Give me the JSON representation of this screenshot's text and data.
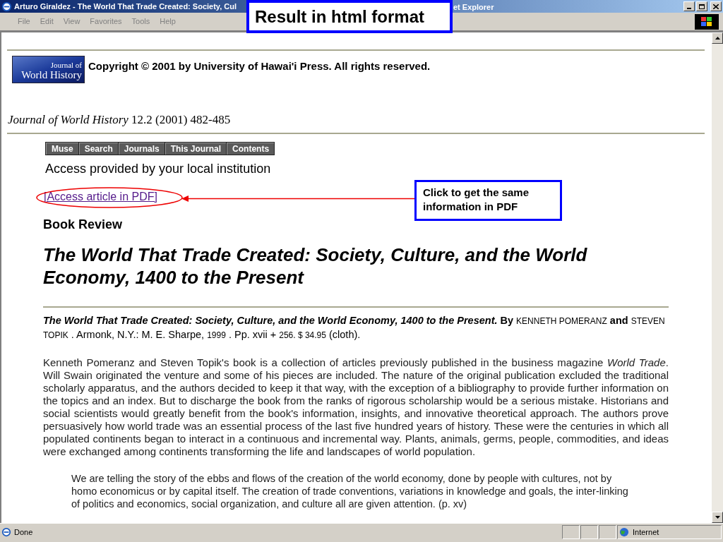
{
  "window": {
    "title_start": "Arturo Giraldez - The World That Trade Created: Society, Cul",
    "title_end": "et Explorer"
  },
  "menu": [
    "File",
    "Edit",
    "View",
    "Favorites",
    "Tools",
    "Help"
  ],
  "page": {
    "logo": [
      "Journal of",
      "World History"
    ],
    "copyright": "Copyright © 2001 by University of Hawai'i Press. All rights reserved.",
    "journal": "Journal of World History",
    "issue": "12.2 (2001) 482-485",
    "nav": [
      "Muse",
      "Search",
      "Journals",
      "This Journal",
      "Contents"
    ],
    "access": "Access provided by your local institution",
    "pdf_link": "[Access article in PDF]",
    "section": "Book Review",
    "title_lines": [
      "The World That Trade Created: Society, Culture, and the World",
      "Economy, 1400 to the Present"
    ],
    "citation": [
      {
        "kind": "title",
        "text": "The World That Trade Created: Society, Culture, and the World Economy, 1400 to the Present."
      },
      {
        "kind": "bold",
        "text": "By"
      },
      {
        "kind": "small",
        "text": "KENNETH POMERANZ"
      },
      {
        "kind": "bold",
        "text": "and"
      },
      {
        "kind": "small",
        "text": "STEVEN TOPIK"
      },
      {
        "kind": "plain",
        "text": ". Armonk, N.Y.: M. E. Sharpe,"
      },
      {
        "kind": "small",
        "text": "1999"
      },
      {
        "kind": "plain",
        "text": ". Pp. xvii +"
      },
      {
        "kind": "small",
        "text": "256. $ 34.95"
      },
      {
        "kind": "plain",
        "text": "(cloth)."
      }
    ],
    "paragraph": "Kenneth Pomeranz and Steven Topik's book is a collection of articles previously published in the business magazine *World Trade*. Will Swain originated the venture and some of his pieces are included. The nature of the original publication excluded the traditional scholarly apparatus, and the authors decided to keep it that way, with the exception of a bibliography to provide further information on the topics and an index. But to discharge the book from the ranks of rigorous scholarship would be a serious mistake. Historians and social scientists would greatly benefit from the book's information, insights, and innovative theoretical approach. The authors prove persuasively how world trade was an essential process of the last five hundred years of history. These were the centuries in which all populated continents began to interact in a continuous and incremental way. Plants, animals, germs, people, commodities, and ideas were exchanged among continents transforming the life and landscapes of world population.",
    "quote": "We are telling the story of the ebbs and flows of the creation of the world economy, done by people with cultures, not by homo economicus or by capital itself. The creation of trade conventions, variations in knowledge and goals, the inter-linking of politics and economics, social organization, and culture all are given attention. (p. xv)"
  },
  "annotations": [
    {
      "kind": "banner",
      "text": "Result in html format"
    },
    {
      "kind": "callout",
      "text": "Click to get the same information in PDF"
    }
  ],
  "status_bar": {
    "status": "Done",
    "zone": "Internet"
  }
}
